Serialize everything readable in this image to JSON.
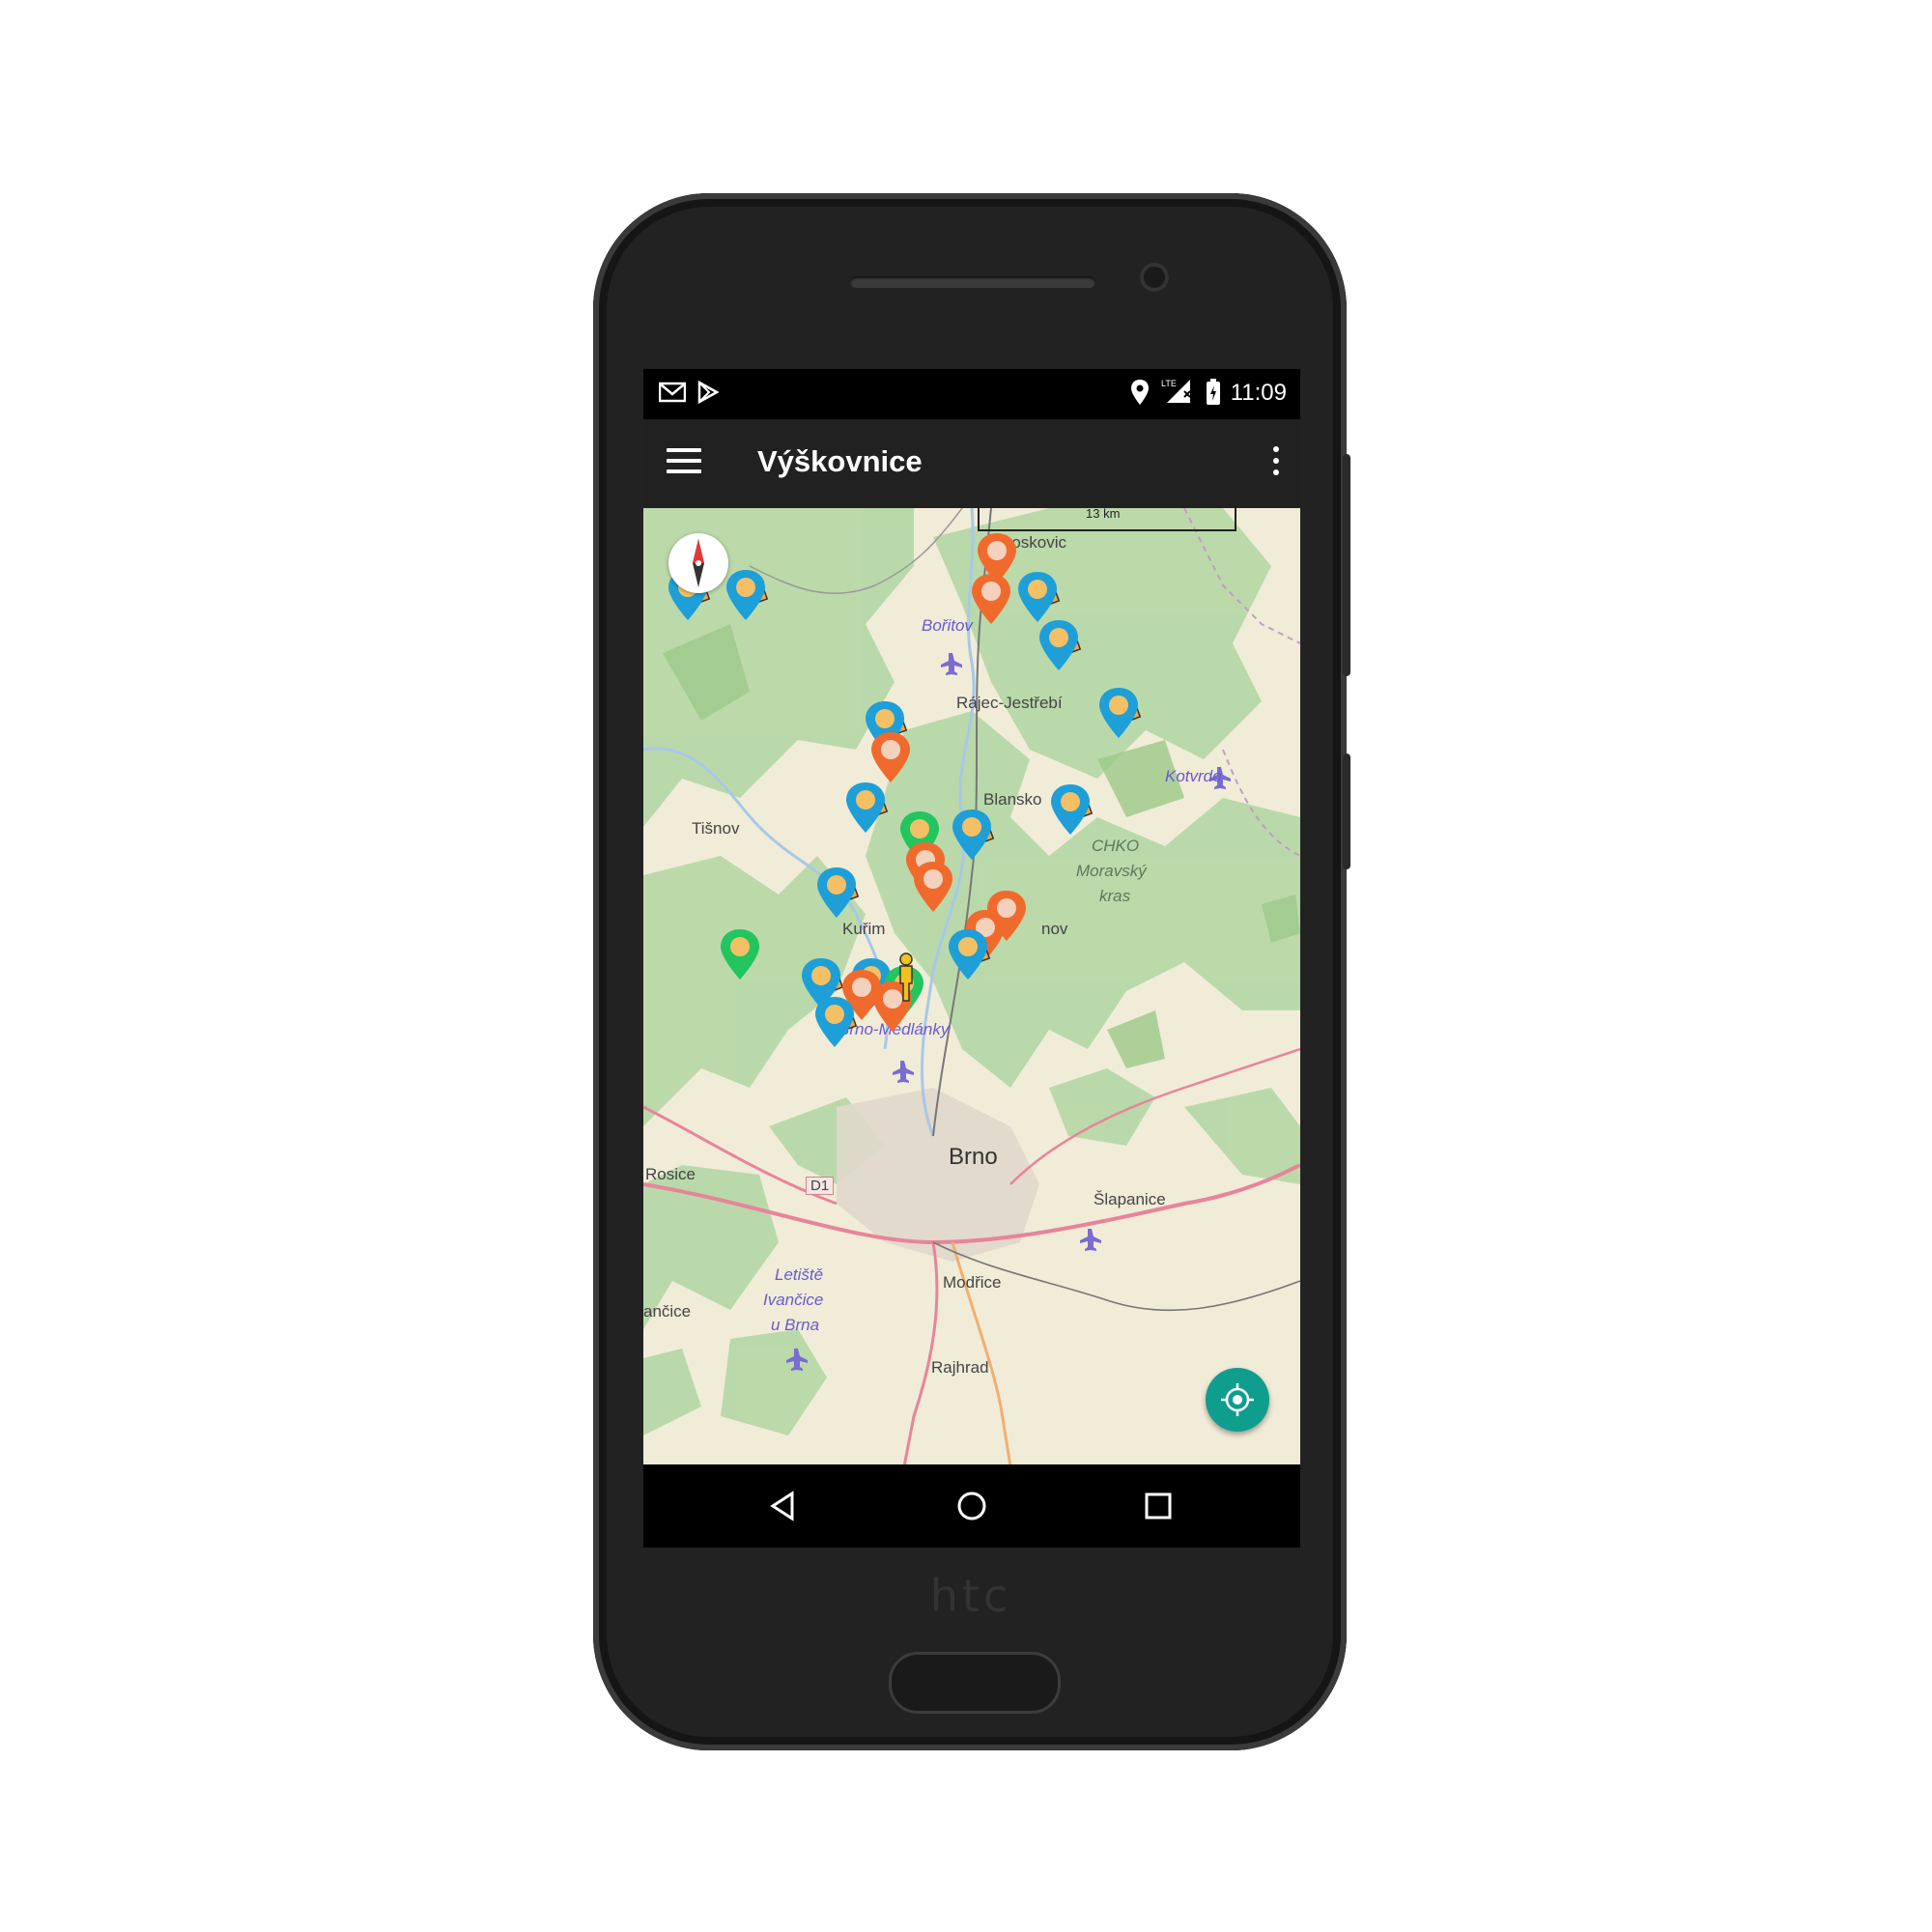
{
  "device": {
    "brand": "htc"
  },
  "status_bar": {
    "time": "11:09",
    "icons": [
      "gmail-icon",
      "play-store-icon",
      "location-icon",
      "lte-signal-icon",
      "battery-charging-icon"
    ]
  },
  "app_bar": {
    "title": "Výškovnice",
    "menu_icon": "hamburger-menu-icon",
    "more_icon": "overflow-menu-icon"
  },
  "map": {
    "scale_label": "13 km",
    "places": {
      "boskovice": "Boskovic",
      "boritov": "Bořitov",
      "rajec": "Rájec-Jestřebí",
      "blansko": "Blansko",
      "tisnov": "Tišnov",
      "kotvrdovice": "Kotvrdo",
      "chko1": "CHKO",
      "chko2": "Moravský",
      "chko3": "kras",
      "kurim": "Kuřim",
      "adamov": "nov",
      "medlanky": "Brno-Medlánky",
      "brno": "Brno",
      "rosice": "Rosice",
      "d1": "D1",
      "slapanice": "Šlapanice",
      "letiste1": "Letiště",
      "letiste2": "Ivančice",
      "letiste3": "u Brna",
      "ivancice": "ančice",
      "modrice": "Modřice",
      "rajhrad": "Rajhrad"
    },
    "marker_colors": {
      "blue": "#1e9fd8",
      "orange": "#f06a2e",
      "green": "#22c55e"
    }
  },
  "nav_bar": {
    "back": "back-icon",
    "home": "home-icon",
    "recents": "recents-icon"
  }
}
